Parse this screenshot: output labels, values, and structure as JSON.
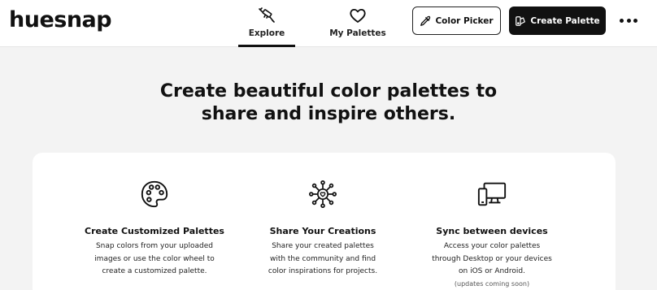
{
  "brand": {
    "logo": "huesnap"
  },
  "nav": {
    "tabs": [
      {
        "label": "Explore",
        "icon": "brush-icon",
        "active": true
      },
      {
        "label": "My Palettes",
        "icon": "heart-icon",
        "active": false
      }
    ]
  },
  "actions": {
    "color_picker": {
      "label": "Color Picker",
      "icon": "eyedropper-icon"
    },
    "create_palette": {
      "label": "Create Palette",
      "icon": "palette-icon"
    },
    "more": {
      "icon": "more-dots-icon"
    }
  },
  "hero": {
    "title_line1": "Create beautiful color palettes to",
    "title_line2": "share and inspire others."
  },
  "features": [
    {
      "icon": "palette-icon",
      "title": "Create Customized Palettes",
      "desc_lines": [
        "Snap colors from your uploaded",
        "images or use the color wheel to",
        "create a customized palette."
      ]
    },
    {
      "icon": "share-network-icon",
      "title": "Share Your Creations",
      "desc_lines": [
        "Share your created palettes",
        "with the community and find",
        "color inspirations for projects."
      ]
    },
    {
      "icon": "devices-icon",
      "title": "Sync between devices",
      "desc_lines": [
        "Access your color palettes",
        "through Desktop or your devices",
        "on iOS or Android."
      ],
      "note": "(updates coming soon)"
    }
  ],
  "colors": {
    "page_bg": "#f3f3f3",
    "card_bg": "#ffffff",
    "primary": "#111111"
  }
}
